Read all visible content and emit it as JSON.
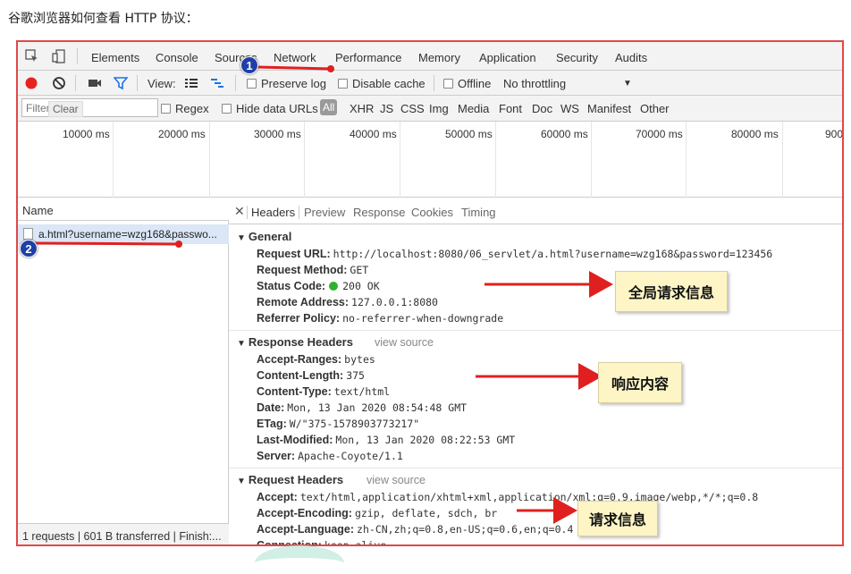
{
  "caption": "谷歌浏览器如何查看 HTTP 协议：",
  "devtools": {
    "panel_tabs": [
      "Elements",
      "Console",
      "Sources",
      "Network",
      "Performance",
      "Memory",
      "Application",
      "Security",
      "Audits"
    ],
    "toolbar": {
      "view_label": "View:",
      "preserve_log": "Preserve log",
      "disable_cache": "Disable cache",
      "offline": "Offline",
      "throttling": "No throttling"
    },
    "filter": {
      "placeholder": "Filter",
      "clear_tooltip": "Clear",
      "regex": "Regex",
      "hide_data_urls": "Hide data URLs",
      "types": [
        "All",
        "XHR",
        "JS",
        "CSS",
        "Img",
        "Media",
        "Font",
        "Doc",
        "WS",
        "Manifest",
        "Other"
      ]
    },
    "timeline_ticks": [
      "10000 ms",
      "20000 ms",
      "30000 ms",
      "40000 ms",
      "50000 ms",
      "60000 ms",
      "70000 ms",
      "80000 ms",
      "900"
    ],
    "request_list": {
      "column_name": "Name",
      "request": "a.html?username=wzg168&passwo...",
      "summary": "1 requests | 601 B transferred | Finish:..."
    },
    "detail_tabs": [
      "Headers",
      "Preview",
      "Response",
      "Cookies",
      "Timing"
    ],
    "general": {
      "title": "General",
      "rows": [
        {
          "key": "Request URL:",
          "value": "http://localhost:8080/06_servlet/a.html?username=wzg168&password=123456"
        },
        {
          "key": "Request Method:",
          "value": "GET"
        },
        {
          "key": "Status Code:",
          "value": "200 OK"
        },
        {
          "key": "Remote Address:",
          "value": "127.0.0.1:8080"
        },
        {
          "key": "Referrer Policy:",
          "value": "no-referrer-when-downgrade"
        }
      ]
    },
    "response_headers": {
      "title": "Response Headers",
      "view_source": "view source",
      "rows": [
        {
          "key": "Accept-Ranges:",
          "value": "bytes"
        },
        {
          "key": "Content-Length:",
          "value": "375"
        },
        {
          "key": "Content-Type:",
          "value": "text/html"
        },
        {
          "key": "Date:",
          "value": "Mon, 13 Jan 2020 08:54:48 GMT"
        },
        {
          "key": "ETag:",
          "value": "W/\"375-1578903773217\""
        },
        {
          "key": "Last-Modified:",
          "value": "Mon, 13 Jan 2020 08:22:53 GMT"
        },
        {
          "key": "Server:",
          "value": "Apache-Coyote/1.1"
        }
      ]
    },
    "request_headers": {
      "title": "Request Headers",
      "view_source": "view source",
      "rows": [
        {
          "key": "Accept:",
          "value": "text/html,application/xhtml+xml,application/xml;q=0.9,image/webp,*/*;q=0.8"
        },
        {
          "key": "Accept-Encoding:",
          "value": "gzip, deflate, sdch, br"
        },
        {
          "key": "Accept-Language:",
          "value": "zh-CN,zh;q=0.8,en-US;q=0.6,en;q=0.4"
        },
        {
          "key": "Connection:",
          "value": "keep-alive"
        }
      ]
    }
  },
  "annotations": {
    "general_note": "全局请求信息",
    "response_note": "响应内容",
    "request_note": "请求信息",
    "badge_1": "1",
    "badge_2": "2"
  },
  "colors": {
    "annotation_red": "#e02020",
    "record_red": "#e8231f",
    "filter_blue": "#1a73e8",
    "badge_blue": "#1f3fa8",
    "status_green": "#2fb02f",
    "note_bg": "#fdf5c6"
  }
}
